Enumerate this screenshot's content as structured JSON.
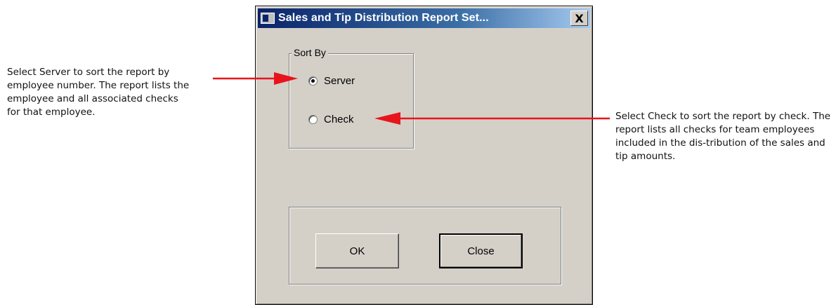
{
  "annotations": {
    "left": "Select Server to sort the report by employee number. The report lists the employee and all associated checks for that employee.",
    "right": "Select Check to sort the report by check. The report lists all checks for team employees included in the dis-tribution of the sales and tip amounts."
  },
  "dialog": {
    "title": "Sales and Tip Distribution Report Set...",
    "close_label": "X",
    "sort_by": {
      "legend": "Sort By",
      "options": [
        {
          "label": "Server",
          "selected": true
        },
        {
          "label": "Check",
          "selected": false
        }
      ]
    },
    "buttons": {
      "ok": "OK",
      "close": "Close"
    }
  },
  "colors": {
    "arrow": "#e8141c",
    "dialog_bg": "#d4d0c8",
    "titlebar": "#0a246a"
  }
}
